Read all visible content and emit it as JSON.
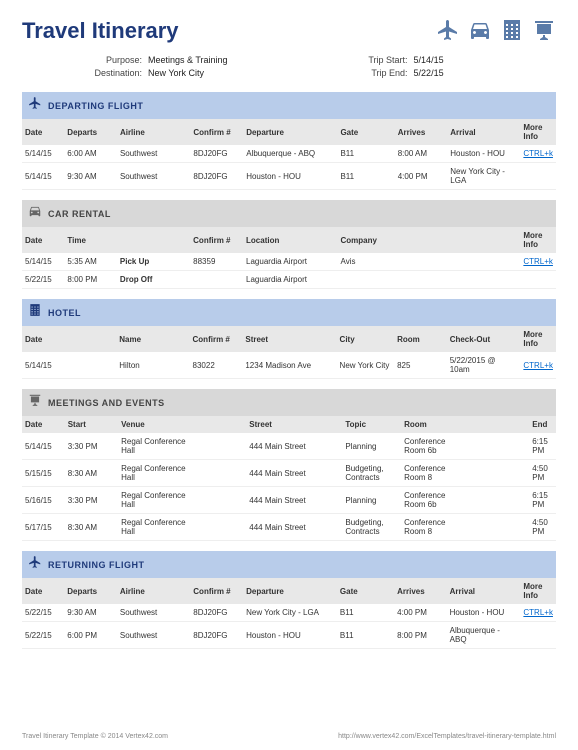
{
  "title": "Travel Itinerary",
  "meta": {
    "purpose_label": "Purpose:",
    "purpose": "Meetings & Training",
    "destination_label": "Destination:",
    "destination": "New York City",
    "trip_start_label": "Trip Start:",
    "trip_start": "5/14/15",
    "trip_end_label": "Trip End:",
    "trip_end": "5/22/15"
  },
  "sections": {
    "departing": {
      "title": "DEPARTING FLIGHT",
      "headers": [
        "Date",
        "Departs",
        "Airline",
        "Confirm #",
        "Departure",
        "Gate",
        "Arrives",
        "Arrival",
        "More Info"
      ],
      "rows": [
        [
          "5/14/15",
          "6:00 AM",
          "Southwest",
          "8DJ20FG",
          "Albuquerque - ABQ",
          "B11",
          "8:00 AM",
          "Houston - HOU",
          "CTRL+k"
        ],
        [
          "5/14/15",
          "9:30 AM",
          "Southwest",
          "8DJ20FG",
          "Houston - HOU",
          "B11",
          "4:00 PM",
          "New York City - LGA",
          ""
        ]
      ]
    },
    "car": {
      "title": "CAR RENTAL",
      "headers": [
        "Date",
        "Time",
        "",
        "Confirm #",
        "Location",
        "Company",
        "",
        "",
        "More Info"
      ],
      "rows": [
        [
          "5/14/15",
          "5:35 AM",
          "Pick Up",
          "88359",
          "Laguardia Airport",
          "Avis",
          "",
          "",
          "CTRL+k"
        ],
        [
          "5/22/15",
          "8:00 PM",
          "Drop Off",
          "",
          "Laguardia Airport",
          "",
          "",
          "",
          ""
        ]
      ]
    },
    "hotel": {
      "title": "HOTEL",
      "headers": [
        "Date",
        "",
        "Name",
        "Confirm #",
        "Street",
        "City",
        "Room",
        "Check-Out",
        "More Info"
      ],
      "rows": [
        [
          "5/14/15",
          "",
          "Hilton",
          "83022",
          "1234 Madison Ave",
          "New York City",
          "825",
          "5/22/2015 @ 10am",
          "CTRL+k"
        ]
      ]
    },
    "meetings": {
      "title": "MEETINGS AND EVENTS",
      "headers": [
        "Date",
        "Start",
        "Venue",
        "",
        "Street",
        "Topic",
        "Room",
        "",
        "End"
      ],
      "rows": [
        [
          "5/14/15",
          "3:30 PM",
          "Regal Conference Hall",
          "",
          "444 Main Street",
          "Planning",
          "Conference Room 6b",
          "",
          "6:15 PM"
        ],
        [
          "5/15/15",
          "8:30 AM",
          "Regal Conference Hall",
          "",
          "444 Main Street",
          "Budgeting, Contracts",
          "Conference Room 8",
          "",
          "4:50 PM"
        ],
        [
          "5/16/15",
          "3:30 PM",
          "Regal Conference Hall",
          "",
          "444 Main Street",
          "Planning",
          "Conference Room 6b",
          "",
          "6:15 PM"
        ],
        [
          "5/17/15",
          "8:30 AM",
          "Regal Conference Hall",
          "",
          "444 Main Street",
          "Budgeting, Contracts",
          "Conference Room 8",
          "",
          "4:50 PM"
        ]
      ]
    },
    "returning": {
      "title": "RETURNING FLIGHT",
      "headers": [
        "Date",
        "Departs",
        "Airline",
        "Confirm #",
        "Departure",
        "Gate",
        "Arrives",
        "Arrival",
        "More Info"
      ],
      "rows": [
        [
          "5/22/15",
          "9:30 AM",
          "Southwest",
          "8DJ20FG",
          "New York City - LGA",
          "B11",
          "4:00 PM",
          "Houston - HOU",
          "CTRL+k"
        ],
        [
          "5/22/15",
          "6:00 PM",
          "Southwest",
          "8DJ20FG",
          "Houston - HOU",
          "B11",
          "8:00 PM",
          "Albuquerque - ABQ",
          ""
        ]
      ]
    }
  },
  "footer": {
    "left": "Travel Itinerary Template © 2014 Vertex42.com",
    "right": "http://www.vertex42.com/ExcelTemplates/travel-itinerary-template.html"
  },
  "link_text": "CTRL+k"
}
